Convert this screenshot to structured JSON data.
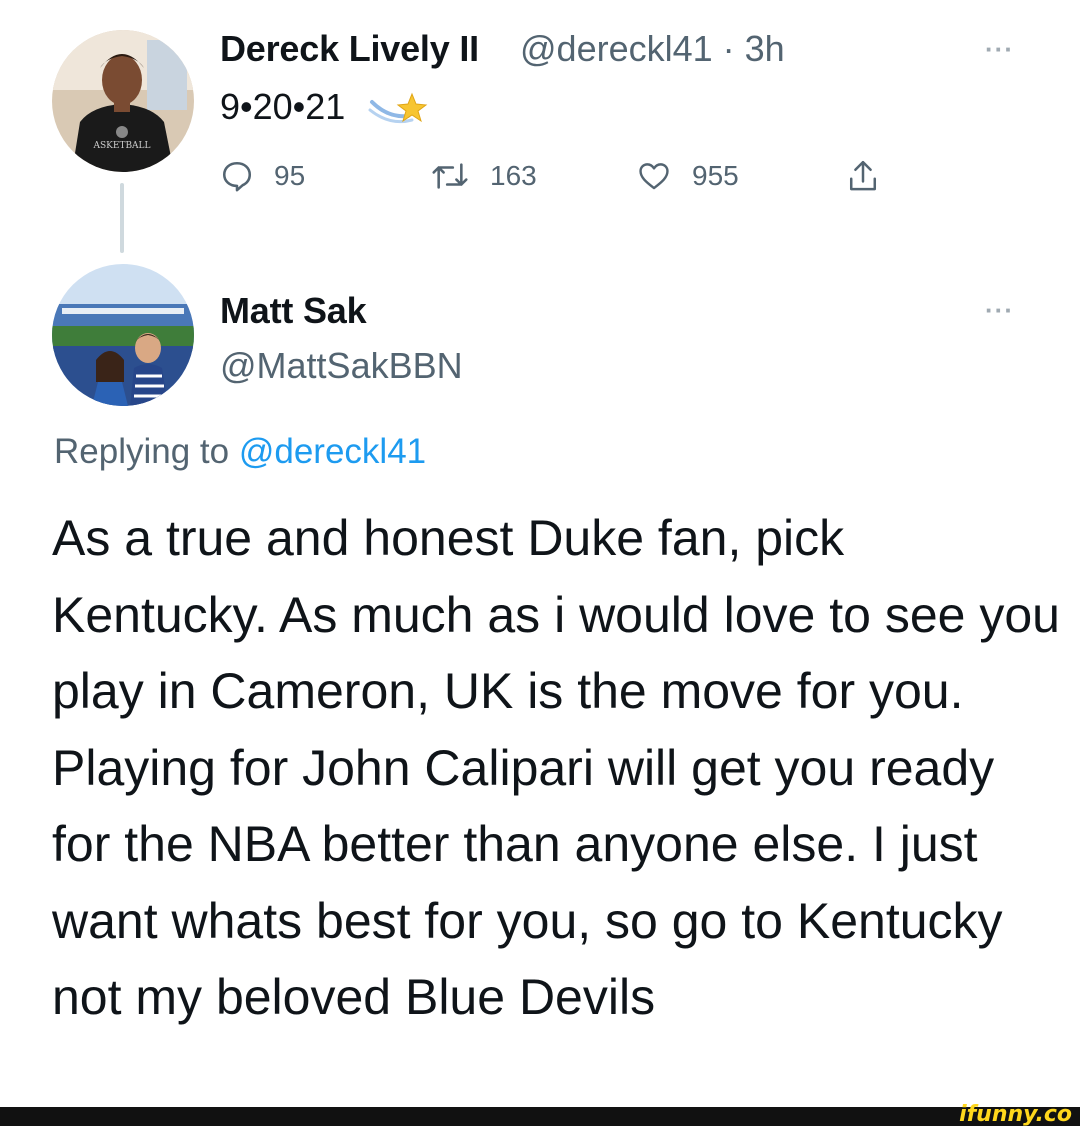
{
  "tweet": {
    "author_name": "Dereck Lively II",
    "author_handle": "@dereckl41 · 3h",
    "more_label": "···",
    "text": "9•20•21",
    "emoji": "shooting-star-icon",
    "reply_count": "95",
    "retweet_count": "163",
    "like_count": "955",
    "avatar_jersey_text": "ASKETBALL"
  },
  "reply": {
    "author_name": "Matt Sak",
    "author_handle": "@MattSakBBN",
    "more_label": "···",
    "replying_prefix": "Replying to",
    "replying_mention": "@dereckl41",
    "text": "As a true and honest Duke fan, pick Kentucky. As much as i would love to see you play in Cameron, UK is the move for you. Playing for John Calipari will get you ready for the NBA better than anyone else. I just want whats best for you, so go to Kentucky not my beloved Blue Devils"
  },
  "watermark": "ifunny.co",
  "colors": {
    "secondary_text": "#536471",
    "link": "#1d9bf0",
    "thread_line": "#cfd9de",
    "watermark": "#ffd71c"
  }
}
